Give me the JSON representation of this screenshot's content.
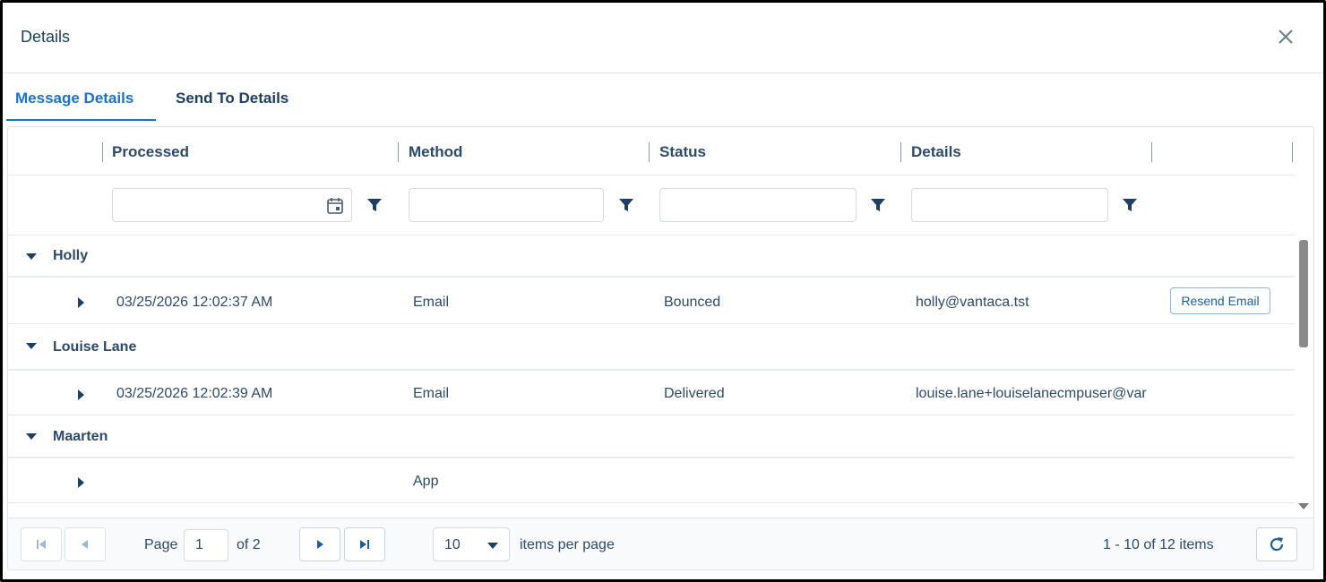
{
  "dialog": {
    "title": "Details"
  },
  "tabs": [
    {
      "label": "Message Details",
      "active": true
    },
    {
      "label": "Send To Details",
      "active": false
    }
  ],
  "grid": {
    "columns": [
      "Processed",
      "Method",
      "Status",
      "Details"
    ],
    "groups": [
      {
        "name": "Holly",
        "rows": [
          {
            "processed": "03/25/2026 12:02:37 AM",
            "method": "Email",
            "status": "Bounced",
            "details": "holly@vantaca.tst",
            "action": "Resend Email"
          }
        ]
      },
      {
        "name": "Louise Lane",
        "rows": [
          {
            "processed": "03/25/2026 12:02:39 AM",
            "method": "Email",
            "status": "Delivered",
            "details": "louise.lane+louiselanecmpuser@var"
          }
        ]
      },
      {
        "name": "Maarten",
        "rows": [
          {
            "processed": "",
            "method": "App",
            "status": "",
            "details": ""
          }
        ]
      }
    ]
  },
  "pager": {
    "page_label": "Page",
    "page_value": "1",
    "of_label": "of 2",
    "page_size": "10",
    "items_per_page_label": "items per page",
    "summary": "1 - 10 of 12 items"
  },
  "colors": {
    "accent": "#1a73c8",
    "text": "#2b4a6c",
    "border": "#dfe3e8"
  }
}
